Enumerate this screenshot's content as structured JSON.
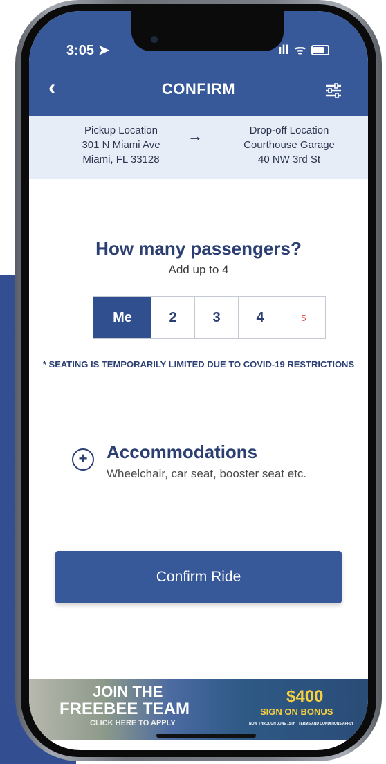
{
  "status_bar": {
    "time": "3:05",
    "signal": "ıll",
    "wifi": "ᯤ"
  },
  "header": {
    "title": "CONFIRM",
    "back_glyph": "‹"
  },
  "route": {
    "pickup": {
      "label": "Pickup Location",
      "address1": "301 N Miami Ave",
      "address2": "Miami, FL 33128"
    },
    "arrow": "→",
    "dropoff": {
      "label": "Drop-off Location",
      "address1": "Courthouse Garage",
      "address2": "40 NW 3rd St"
    }
  },
  "passengers": {
    "question": "How many passengers?",
    "subtitle": "Add up to 4",
    "options": [
      "Me",
      "2",
      "3",
      "4",
      "5"
    ],
    "selected": "Me"
  },
  "notice": "* SEATING IS TEMPORARILY LIMITED DUE TO COVID-19 RESTRICTIONS",
  "accommodations": {
    "plus": "+",
    "title": "Accommodations",
    "subtitle": "Wheelchair, car seat, booster seat etc."
  },
  "confirm_button": "Confirm Ride",
  "banner": {
    "join": "JOIN THE",
    "team": "FREEBEE TEAM",
    "apply": "CLICK HERE TO APPLY",
    "amount": "$400",
    "bonus": "SIGN ON BONUS",
    "fine_print": "NOW THROUGH JUNE 15TH | TERMS AND CONDITIONS APPLY"
  },
  "colors": {
    "brand_blue": "#37599a",
    "accent_red": "#e05757",
    "route_bg": "#e7edf7"
  }
}
